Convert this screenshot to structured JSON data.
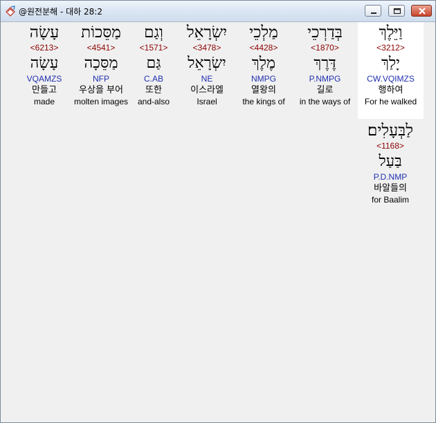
{
  "window": {
    "title": "@원전분해 - 대하 28:2",
    "icon": "app-book-icon",
    "controls": [
      "minimize-icon",
      "maximize-icon",
      "close-icon"
    ]
  },
  "words": [
    {
      "hebrew": "וַיֵּלֶךְ",
      "strong": "<3212>",
      "lemma": "יָלַךְ",
      "morph": "CW.VQIMZS",
      "korean": "행하여",
      "english": "For he walked"
    },
    {
      "hebrew": "בְּדַרְכֵי",
      "strong": "<1870>",
      "lemma": "דֶּרֶךְ",
      "morph": "P.NMPG",
      "korean": "길로",
      "english": "in the ways of"
    },
    {
      "hebrew": "מַלְכֵי",
      "strong": "<4428>",
      "lemma": "מֶלֶךְ",
      "morph": "NMPG",
      "korean": "열왕의",
      "english": "the kings of"
    },
    {
      "hebrew": "יִשְׂרָאֵל",
      "strong": "<3478>",
      "lemma": "יִשְׂרָאֵל",
      "morph": "NE",
      "korean": "이스라엘",
      "english": "Israel"
    },
    {
      "hebrew": "וְגַם",
      "strong": "<1571>",
      "lemma": "גַּם",
      "morph": "C.AB",
      "korean": "또한",
      "english": "and-also"
    },
    {
      "hebrew": "מַסֵּכוֹת",
      "strong": "<4541>",
      "lemma": "מַסֵּכָה",
      "morph": "NFP",
      "korean": "우상을 부어",
      "english": "molten images"
    },
    {
      "hebrew": "עָשָׂה",
      "strong": "<6213>",
      "lemma": "עָשָׂה",
      "morph": "VQAMZS",
      "korean": "만들고",
      "english": "made"
    },
    {
      "hebrew": "לַבְּעָלִים׃",
      "strong": "<1168>",
      "lemma": "בַּעַל",
      "morph": "P.D.NMP",
      "korean": "바알들의",
      "english": "for Baalim"
    }
  ]
}
